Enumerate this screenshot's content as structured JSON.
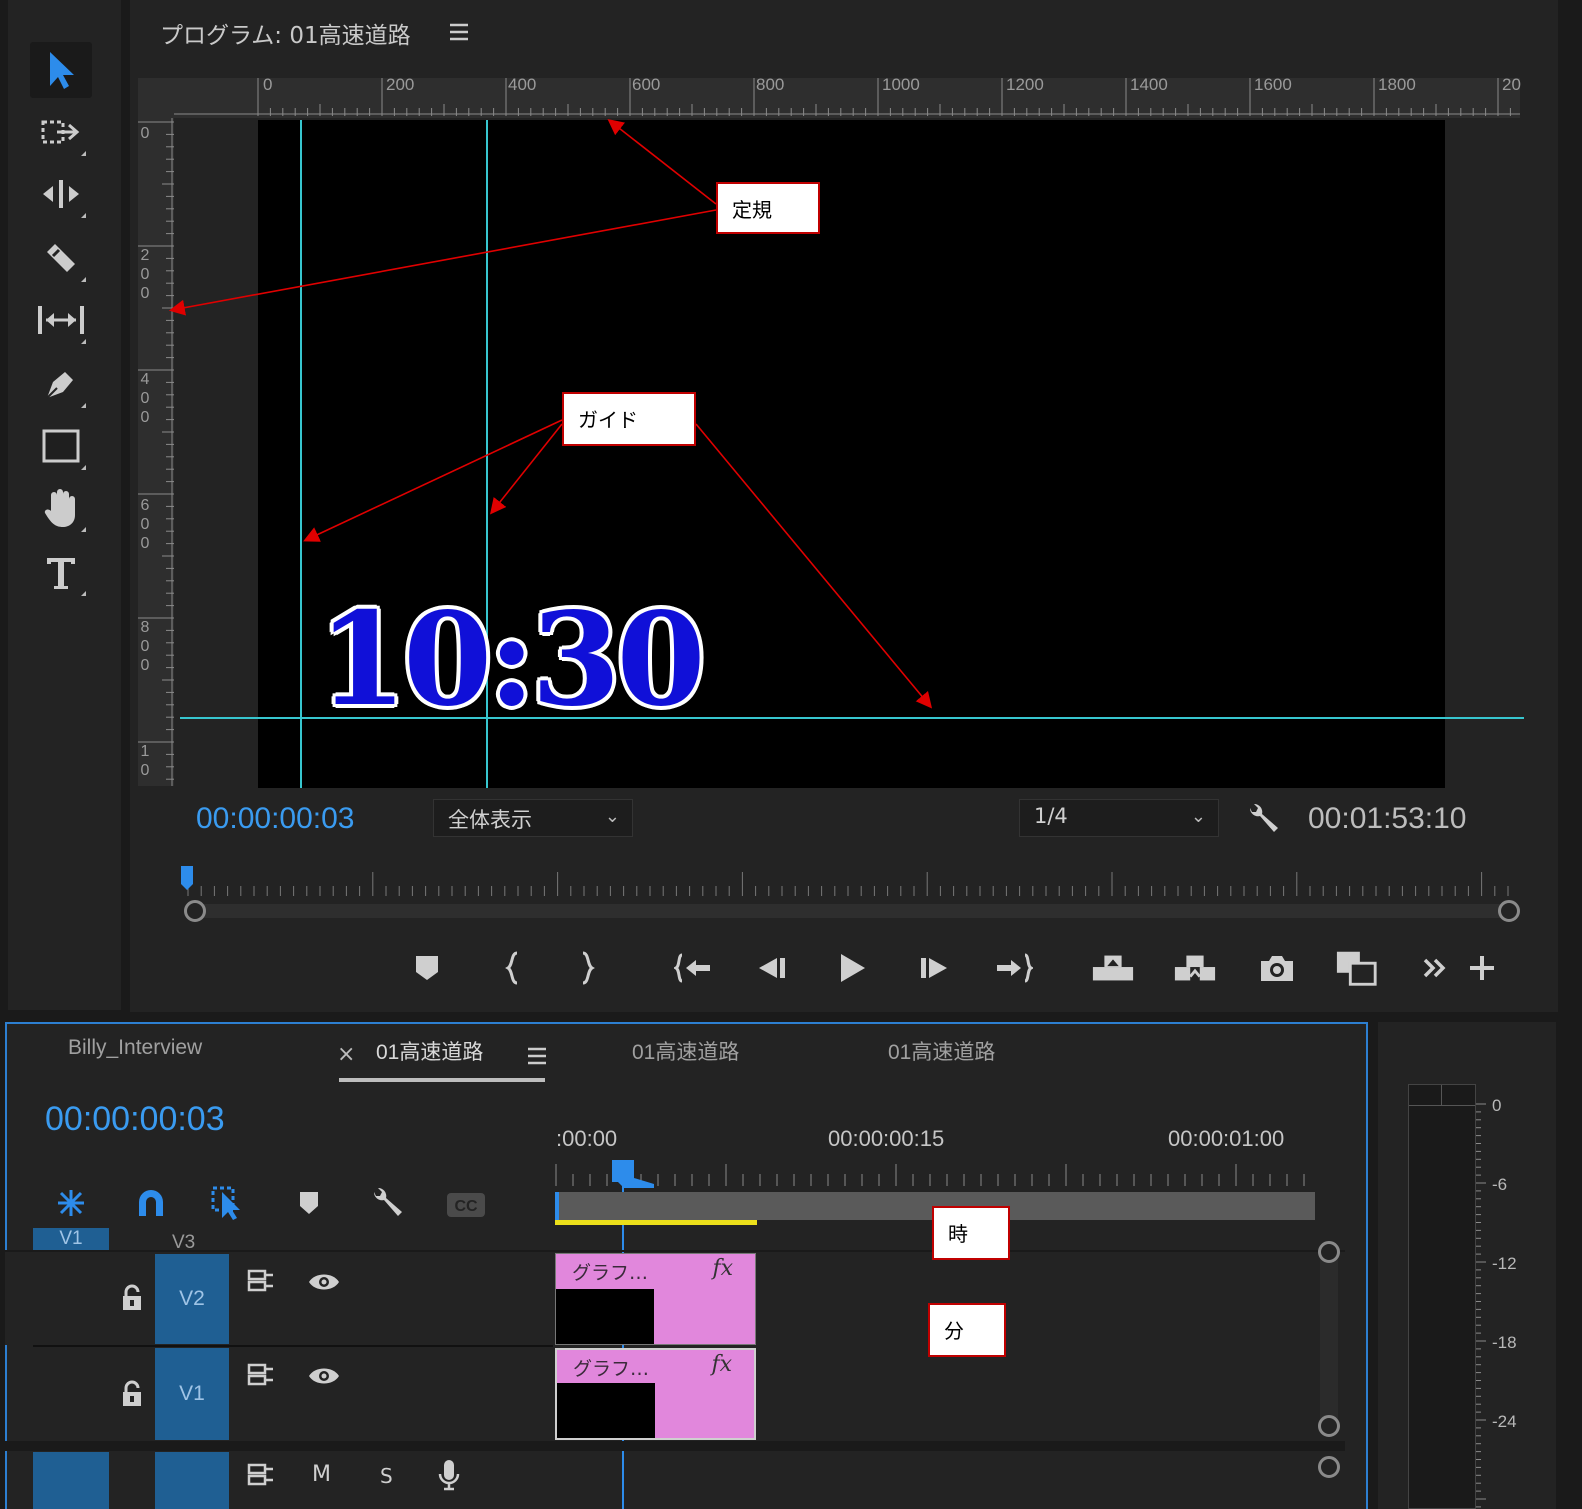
{
  "program_monitor": {
    "title": "プログラム: 01高速道路",
    "ruler_h_labels": [
      "0",
      "200",
      "400",
      "600",
      "800",
      "1000",
      "1200",
      "1400",
      "1600",
      "1800",
      "20"
    ],
    "ruler_v_labels": [
      "0",
      "200",
      "400",
      "600",
      "800",
      "10"
    ],
    "clock_text": "10:30",
    "current_timecode": "00:00:00:03",
    "zoom_select": "全体表示",
    "resolution_select": "1/4",
    "duration_timecode": "00:01:53:10"
  },
  "callouts": {
    "ruler": "定規",
    "guide": "ガイド",
    "hour": "時",
    "minute": "分"
  },
  "timeline": {
    "tabs": [
      "Billy_Interview",
      "01高速道路",
      "01高速道路",
      "01高速道路"
    ],
    "close_glyph": "×",
    "current_timecode": "00:00:00:03",
    "ruler_labels": [
      ":00:00",
      "00:00:00:15",
      "00:00:01:00"
    ],
    "source_patch_v1": "V1",
    "track_v3": "V3",
    "tracks": [
      {
        "name": "V2",
        "clip_name": "グラフ…",
        "fx": "fx"
      },
      {
        "name": "V1",
        "clip_name": "グラフ…",
        "fx": "fx"
      }
    ],
    "audio_buttons": [
      "M",
      "S"
    ]
  },
  "audio_meter": {
    "labels": [
      "0",
      "-6",
      "-12",
      "-18",
      "-24"
    ]
  },
  "colors": {
    "accent_blue": "#3a9bf0",
    "guide_cyan": "#37c6cf",
    "clip_pink": "#e187dc",
    "callout_red": "#c00000"
  }
}
